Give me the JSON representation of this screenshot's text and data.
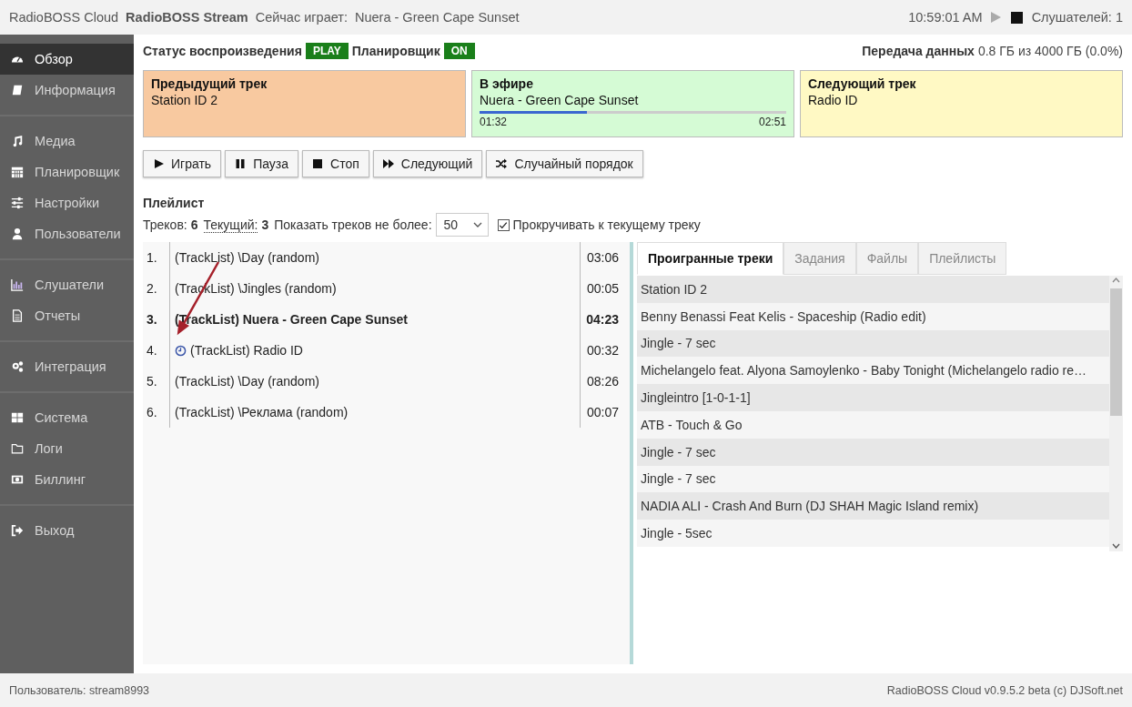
{
  "header": {
    "app_name": "RadioBOSS Cloud",
    "station": "RadioBOSS Stream",
    "now_playing_label": "Сейчас играет:",
    "now_playing": "Nuera - Green Cape Sunset",
    "time": "10:59:01 AM",
    "listeners": "Слушателей: 1"
  },
  "sidebar": {
    "groups": [
      [
        {
          "label": "Обзор",
          "selected": true
        },
        {
          "label": "Информация",
          "selected": false
        }
      ],
      [
        {
          "label": "Медиа",
          "selected": false
        },
        {
          "label": "Планировщик",
          "selected": false
        },
        {
          "label": "Настройки",
          "selected": false
        },
        {
          "label": "Пользователи",
          "selected": false
        }
      ],
      [
        {
          "label": "Слушатели",
          "selected": false
        },
        {
          "label": "Отчеты",
          "selected": false
        }
      ],
      [
        {
          "label": "Интеграция",
          "selected": false
        }
      ],
      [
        {
          "label": "Система",
          "selected": false
        },
        {
          "label": "Логи",
          "selected": false
        },
        {
          "label": "Биллинг",
          "selected": false
        }
      ],
      [
        {
          "label": "Выход",
          "selected": false
        }
      ]
    ]
  },
  "status": {
    "playback_label": "Статус воспроизведения",
    "playback_badge": "PLAY",
    "scheduler_label": "Планировщик",
    "scheduler_badge": "ON",
    "transfer_label": "Передача данных",
    "transfer_value": "0.8 ГБ из 4000 ГБ (0.0%)"
  },
  "tracks": [
    {
      "kind": "previous",
      "title": "Предыдущий трек",
      "track": "Station ID 2"
    },
    {
      "kind": "on_air",
      "title": "В эфире",
      "track": "Nuera - Green Cape Sunset",
      "level": 0.35,
      "elapsed": "01:32",
      "remaining": "02:51"
    },
    {
      "kind": "next",
      "title": "Следующий трек",
      "track": "Radio ID"
    }
  ],
  "buttons": [
    "Играть",
    "Пауза",
    "Стоп",
    "Следующий",
    "Случайный порядок"
  ],
  "playlist": {
    "title": "Плейлист",
    "tracks_label": "Треков:",
    "tracks_count": "6",
    "current_label": "Текущий:",
    "current_value": "3",
    "limit_label": "Показать треков не более:",
    "limit_value": "50",
    "scroll_label": "Прокручивать к текущему треку",
    "scroll_checked": true,
    "rows": [
      {
        "number": "1.",
        "title": "(TrackList) \\Day (random)",
        "duration": "03:06",
        "current": false,
        "scheduled": false
      },
      {
        "number": "2.",
        "title": "(TrackList) \\Jingles (random)",
        "duration": "00:05",
        "current": false,
        "scheduled": false
      },
      {
        "number": "3.",
        "title": "(TrackList) Nuera - Green Cape Sunset",
        "duration": "04:23",
        "current": true,
        "scheduled": false
      },
      {
        "number": "4.",
        "title": "(TrackList) Radio ID",
        "duration": "00:32",
        "current": false,
        "scheduled": true
      },
      {
        "number": "5.",
        "title": "(TrackList) \\Day (random)",
        "duration": "08:26",
        "current": false,
        "scheduled": false
      },
      {
        "number": "6.",
        "title": "(TrackList) \\Реклама (random)",
        "duration": "00:07",
        "current": false,
        "scheduled": false
      }
    ]
  },
  "history": {
    "tabs": [
      {
        "label": "Проигранные треки",
        "selected": true
      },
      {
        "label": "Задания",
        "selected": false
      },
      {
        "label": "Файлы",
        "selected": false
      },
      {
        "label": "Плейлисты",
        "selected": false
      }
    ],
    "rows": [
      "Station ID 2",
      "Benny Benassi Feat Kelis - Spaceship (Radio edit)",
      "Jingle - 7 sec",
      "Michelangelo feat. Alyona Samoylenko - Baby Tonight (Michelangelo radio re…",
      "Jingleintro [1-0-1-1]",
      "ATB - Touch & Go",
      "Jingle - 7 sec",
      "Jingle - 7 sec",
      "NADIA ALI - Crash And Burn (DJ SHAH Magic Island remix)",
      "Jingle - 5sec"
    ]
  },
  "footer": {
    "user": "Пользователь: stream8993",
    "version": "RadioBOSS Cloud v0.9.5.2 beta (c) DJSoft.net"
  }
}
